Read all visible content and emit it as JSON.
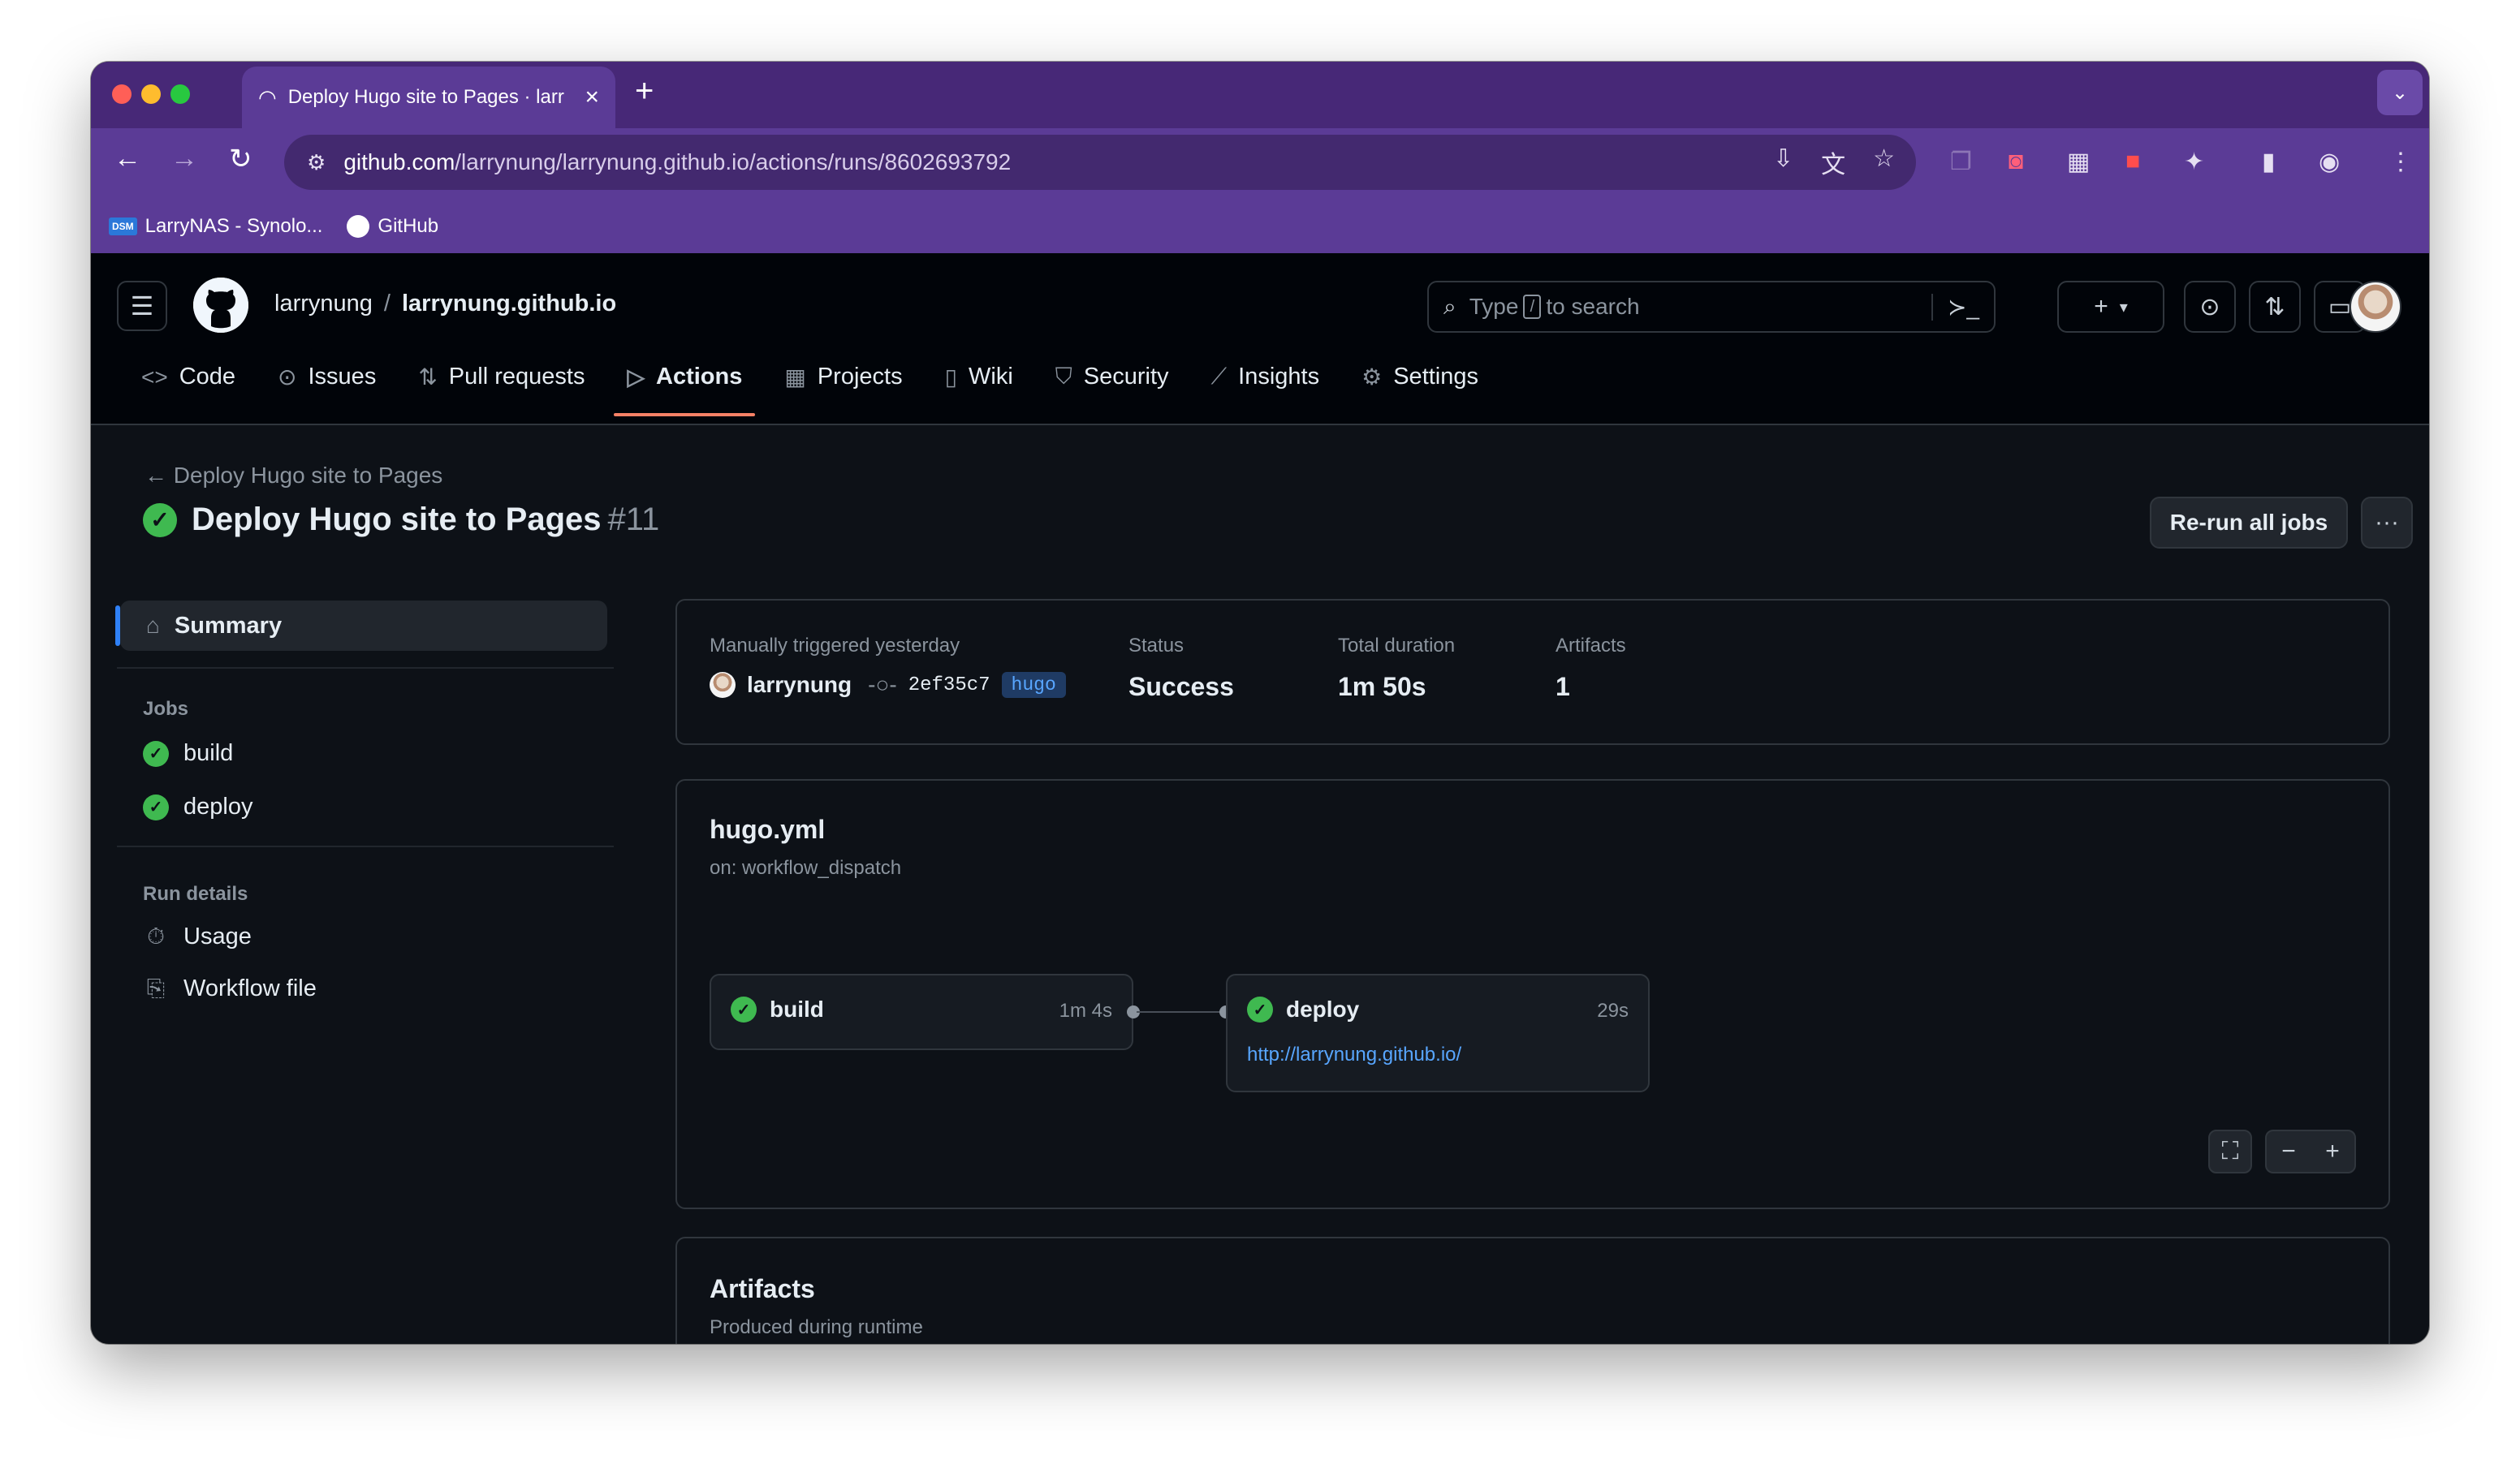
{
  "browser": {
    "tab_title": "Deploy Hugo site to Pages · larrynung/larrynung.github.io",
    "url_host": "github.com",
    "url_path": "/larrynung/larrynung.github.io/actions/runs/8602693792",
    "bookmarks": [
      {
        "icon": "dsm-icon",
        "label": "LarryNAS - Synolo..."
      },
      {
        "icon": "github-icon",
        "label": "GitHub"
      }
    ]
  },
  "header": {
    "owner": "larrynung",
    "separator": "/",
    "repo": "larrynung.github.io",
    "search_prefix": "Type",
    "search_key": "/",
    "search_suffix": "to search"
  },
  "repo_nav": [
    {
      "label": "Code",
      "icon": "code-icon"
    },
    {
      "label": "Issues",
      "icon": "issue-icon"
    },
    {
      "label": "Pull requests",
      "icon": "pull-request-icon"
    },
    {
      "label": "Actions",
      "icon": "play-icon",
      "active": true
    },
    {
      "label": "Projects",
      "icon": "table-icon"
    },
    {
      "label": "Wiki",
      "icon": "book-icon"
    },
    {
      "label": "Security",
      "icon": "shield-icon"
    },
    {
      "label": "Insights",
      "icon": "graph-icon"
    },
    {
      "label": "Settings",
      "icon": "gear-icon"
    }
  ],
  "run": {
    "back_label": "Deploy Hugo site to Pages",
    "title": "Deploy Hugo site to Pages",
    "number": "#11",
    "rerun_label": "Re-run all jobs"
  },
  "sidebar": {
    "summary": "Summary",
    "jobs_heading": "Jobs",
    "jobs": [
      "build",
      "deploy"
    ],
    "details_heading": "Run details",
    "details": [
      {
        "label": "Usage",
        "icon": "stopwatch-icon"
      },
      {
        "label": "Workflow file",
        "icon": "file-code-icon"
      }
    ]
  },
  "summary": {
    "trigger_label": "Manually triggered yesterday",
    "actor": "larrynung",
    "commit": "2ef35c7",
    "branch": "hugo",
    "status_label": "Status",
    "status_value": "Success",
    "duration_label": "Total duration",
    "duration_value": "1m 50s",
    "artifacts_label": "Artifacts",
    "artifacts_value": "1"
  },
  "workflow": {
    "file": "hugo.yml",
    "trigger": "on: workflow_dispatch",
    "jobs": [
      {
        "name": "build",
        "duration": "1m 4s"
      },
      {
        "name": "deploy",
        "duration": "29s",
        "link": "http://larrynung.github.io/"
      }
    ]
  },
  "artifacts": {
    "title": "Artifacts",
    "subtitle": "Produced during runtime"
  },
  "colors": {
    "accent_purple": "#5b3b96",
    "success_green": "#3fb950",
    "link_blue": "#58a6ff",
    "active_underline": "#f78166"
  }
}
